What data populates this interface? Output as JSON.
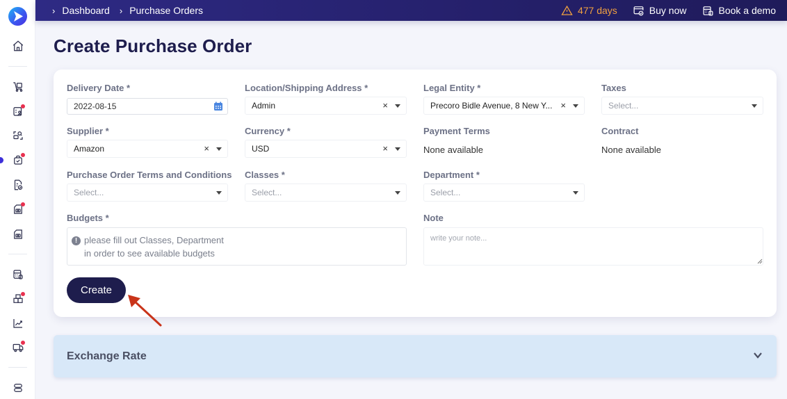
{
  "breadcrumb": [
    "Dashboard",
    "Purchase Orders"
  ],
  "topbar": {
    "trial_days": "477 days",
    "buy_now": "Buy now",
    "book_demo": "Book a demo"
  },
  "page_title": "Create Purchase Order",
  "form": {
    "delivery_date": {
      "label": "Delivery Date *",
      "value": "2022-08-15"
    },
    "location": {
      "label": "Location/Shipping Address *",
      "value": "Admin",
      "clear": "×"
    },
    "legal_entity": {
      "label": "Legal Entity *",
      "value": "Precoro Bidle Avenue, 8 New Y...",
      "clear": "×"
    },
    "taxes": {
      "label": "Taxes",
      "placeholder": "Select..."
    },
    "supplier": {
      "label": "Supplier *",
      "value": "Amazon",
      "clear": "×"
    },
    "currency": {
      "label": "Currency *",
      "value": "USD",
      "clear": "×"
    },
    "payment_terms": {
      "label": "Payment Terms",
      "value": "None available"
    },
    "contract": {
      "label": "Contract",
      "value": "None available"
    },
    "terms": {
      "label": "Purchase Order Terms and Conditions",
      "placeholder": "Select..."
    },
    "classes": {
      "label": "Classes *",
      "placeholder": "Select..."
    },
    "department": {
      "label": "Department *",
      "placeholder": "Select..."
    },
    "budgets": {
      "label": "Budgets *",
      "info_icon": "!",
      "line1": "please fill out Classes, Department",
      "line2": "in order to see available budgets"
    },
    "note": {
      "label": "Note",
      "placeholder": "write your note..."
    },
    "create_label": "Create"
  },
  "exchange_rate": {
    "title": "Exchange Rate"
  },
  "colors": {
    "topbar": "#2e2a84",
    "primary": "#1e1d4d",
    "warning": "#f0a040",
    "notification": "#e8304f",
    "exchange_bg": "#d8e8f8"
  }
}
